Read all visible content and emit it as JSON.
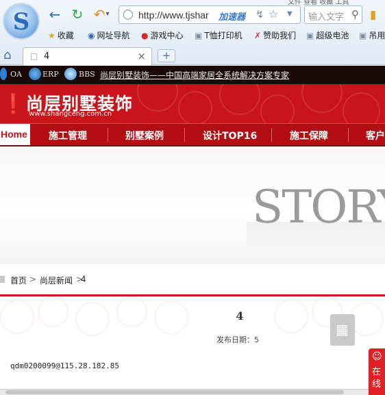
{
  "browser": {
    "logo_letter": "S",
    "top_text": "文件  查看  收藏  工具",
    "address": "http://www.tjshar",
    "accelerator_label": "加速器",
    "search_placeholder": "输入文字",
    "bookmarks": [
      {
        "label": "收藏",
        "icon": "star-icon"
      },
      {
        "label": "网址导航",
        "icon": "sogou-icon"
      },
      {
        "label": "游戏中心",
        "icon": "game-icon"
      },
      {
        "label": "T恤打印机",
        "icon": "folder-icon"
      },
      {
        "label": "赞助我们",
        "icon": "sponsor-icon"
      },
      {
        "label": "超级电池",
        "icon": "folder-icon"
      },
      {
        "label": "吊用",
        "icon": "folder-icon"
      }
    ],
    "tab_title": "4",
    "new_tab_label": "+"
  },
  "site": {
    "topbar": {
      "links": [
        "OA",
        "ERP",
        "BBS"
      ],
      "slogan": "尚层别墅装饰——中国高端家居全系统解决方案专家"
    },
    "brand": {
      "name": "尚层别墅装饰",
      "url": "www.shangceng.com.cn"
    },
    "nav": [
      "Home",
      "施工管理",
      "别墅案例",
      "设计TOP16",
      "施工保障",
      "客户"
    ],
    "banner_text": "STORY",
    "breadcrumb": [
      "首页",
      "尚层新闻",
      "4"
    ],
    "article": {
      "title": "4",
      "date_label": "发布日期：5",
      "body": "qdm0200099@115.28.182.85"
    },
    "online_label": "在线"
  }
}
